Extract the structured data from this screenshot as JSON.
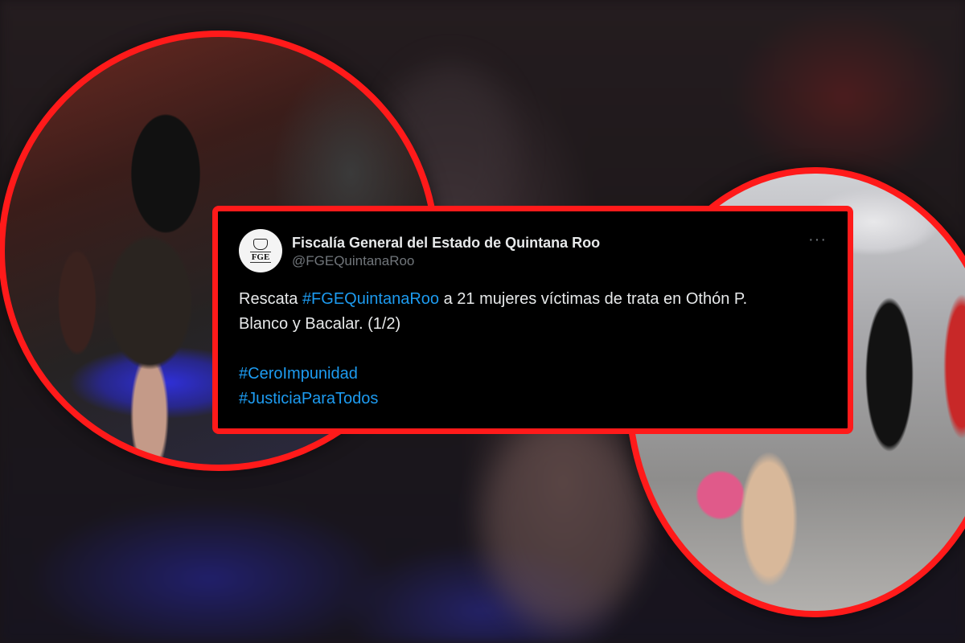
{
  "tweet": {
    "account_name": "Fiscalía General del Estado de Quintana Roo",
    "handle": "@FGEQuintanaRoo",
    "avatar_logo_text": "FGE",
    "more_icon": "more-horizontal-icon",
    "text_part1": "Rescata ",
    "hashtag_main": "#FGEQuintanaRoo",
    "text_part2": " a 21 mujeres víctimas de trata en Othón P.",
    "text_line2": "Blanco y Bacalar. (1/2)",
    "hashtag_1": "#CeroImpunidad",
    "hashtag_2": "#JusticiaParaTodos"
  },
  "colors": {
    "highlight_border": "#ff1a1a",
    "tweet_background": "#000000",
    "hashtag": "#1d9bf0",
    "handle": "#71767b",
    "text": "#e7e9ea"
  }
}
